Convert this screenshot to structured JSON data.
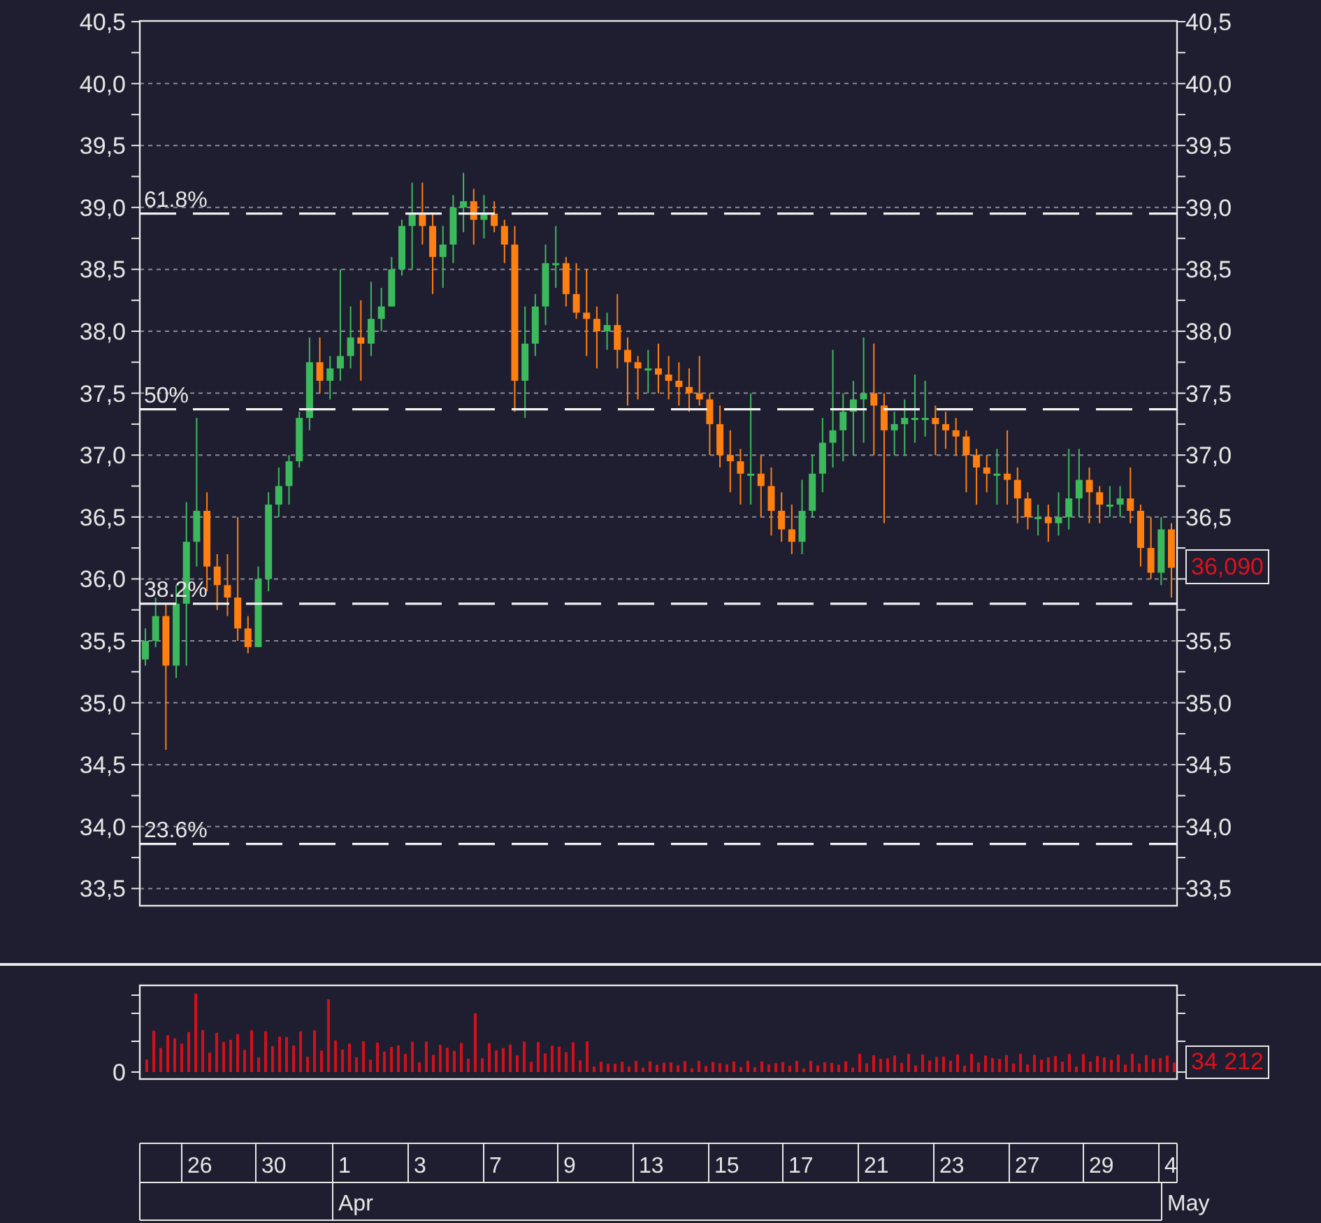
{
  "price_chart": {
    "right_axis": {
      "ticks": [
        "40,5",
        "40,0",
        "39,5",
        "39,0",
        "38,5",
        "38,0",
        "37,5",
        "37,0",
        "36,5",
        "35,5",
        "35,0",
        "34,5",
        "34,0",
        "33,5"
      ]
    },
    "fibonacci_levels": [
      {
        "label": "61.8%"
      },
      {
        "label": "50%"
      },
      {
        "label": "38.2%"
      },
      {
        "label": "23.6%"
      }
    ],
    "last_price": "36,090",
    "chart_data": {
      "type": "candlestick",
      "grid": true,
      "ylim": [
        33.36,
        40.5
      ],
      "yticks": [
        {
          "value": 40.5,
          "label": "40,5"
        },
        {
          "value": 40,
          "label": "40,0"
        },
        {
          "value": 39.5,
          "label": "39,5"
        },
        {
          "value": 39,
          "label": "39,0"
        },
        {
          "value": 38.5,
          "label": "38,5"
        },
        {
          "value": 38,
          "label": "38,0"
        },
        {
          "value": 37.5,
          "label": "37,5"
        },
        {
          "value": 37,
          "label": "37,0"
        },
        {
          "value": 36.5,
          "label": "36,5"
        },
        {
          "value": 36,
          "label": "36,0"
        },
        {
          "value": 35.5,
          "label": "35,5"
        },
        {
          "value": 35,
          "label": "35,0"
        },
        {
          "value": 34.5,
          "label": "34,5"
        },
        {
          "value": 34,
          "label": "34,0"
        },
        {
          "value": 33.5,
          "label": "33,5"
        }
      ],
      "categories": [
        null,
        null,
        null,
        null,
        null,
        null,
        null,
        null,
        null,
        null,
        null,
        null,
        null,
        null,
        null,
        null,
        null,
        null,
        null,
        null,
        null,
        null,
        null,
        null,
        null,
        null,
        null,
        null,
        null,
        null,
        null,
        null,
        null,
        null,
        null,
        null,
        null,
        null,
        null,
        null,
        null,
        null,
        null,
        null,
        null,
        null,
        null,
        null,
        null,
        null,
        null,
        null,
        null,
        null,
        null,
        null,
        null,
        null,
        null,
        null,
        null,
        null,
        null,
        null,
        null,
        null,
        null,
        null,
        null,
        null,
        null,
        null,
        null,
        null,
        null,
        null,
        null,
        null,
        null,
        null,
        null,
        null,
        null,
        null,
        null,
        null,
        null,
        null,
        null,
        null,
        null,
        null,
        null,
        null,
        null,
        null,
        null,
        null,
        null,
        null,
        null
      ],
      "ohlc": [
        [
          35.35,
          35.6,
          35.3,
          35.5
        ],
        [
          35.5,
          35.85,
          35.45,
          35.7
        ],
        [
          35.7,
          35.8,
          34.62,
          35.3
        ],
        [
          35.3,
          35.95,
          35.2,
          35.8
        ],
        [
          35.8,
          36.62,
          35.3,
          36.3
        ],
        [
          36.3,
          37.3,
          36.1,
          36.55
        ],
        [
          36.55,
          36.7,
          35.9,
          36.1
        ],
        [
          36.1,
          36.2,
          35.75,
          35.95
        ],
        [
          35.95,
          36.2,
          35.7,
          35.85
        ],
        [
          35.85,
          36.5,
          35.5,
          35.6
        ],
        [
          35.6,
          35.7,
          35.4,
          35.45
        ],
        [
          35.45,
          36.1,
          35.45,
          36.0
        ],
        [
          36.0,
          36.7,
          35.9,
          36.6
        ],
        [
          36.6,
          36.9,
          36.5,
          36.75
        ],
        [
          36.75,
          37.0,
          36.6,
          36.95
        ],
        [
          36.95,
          37.35,
          36.9,
          37.3
        ],
        [
          37.3,
          37.95,
          37.2,
          37.75
        ],
        [
          37.75,
          37.95,
          37.5,
          37.6
        ],
        [
          37.6,
          37.8,
          37.45,
          37.7
        ],
        [
          37.7,
          38.5,
          37.6,
          37.8
        ],
        [
          37.8,
          38.2,
          37.7,
          37.95
        ],
        [
          37.95,
          38.25,
          37.6,
          37.9
        ],
        [
          37.9,
          38.4,
          37.8,
          38.1
        ],
        [
          38.1,
          38.35,
          38.0,
          38.2
        ],
        [
          38.2,
          38.6,
          38.2,
          38.5
        ],
        [
          38.5,
          38.9,
          38.45,
          38.85
        ],
        [
          38.85,
          39.2,
          38.5,
          38.95
        ],
        [
          38.95,
          39.2,
          38.7,
          38.85
        ],
        [
          38.85,
          38.95,
          38.3,
          38.6
        ],
        [
          38.6,
          38.85,
          38.35,
          38.7
        ],
        [
          38.7,
          39.1,
          38.55,
          39.0
        ],
        [
          39.0,
          39.28,
          38.8,
          39.05
        ],
        [
          39.05,
          39.15,
          38.7,
          38.9
        ],
        [
          38.9,
          39.1,
          38.75,
          38.95
        ],
        [
          38.95,
          39.05,
          38.8,
          38.85
        ],
        [
          38.85,
          38.9,
          38.55,
          38.7
        ],
        [
          38.7,
          38.85,
          37.35,
          37.6
        ],
        [
          37.6,
          38.2,
          37.3,
          37.9
        ],
        [
          37.9,
          38.3,
          37.8,
          38.2
        ],
        [
          38.2,
          38.7,
          38.05,
          38.55
        ],
        [
          38.55,
          38.85,
          38.35,
          38.55
        ],
        [
          38.55,
          38.6,
          38.2,
          38.3
        ],
        [
          38.3,
          38.55,
          38.1,
          38.15
        ],
        [
          38.15,
          38.5,
          37.8,
          38.1
        ],
        [
          38.1,
          38.2,
          37.7,
          38.0
        ],
        [
          38.0,
          38.15,
          37.85,
          38.05
        ],
        [
          38.05,
          38.3,
          37.7,
          37.85
        ],
        [
          37.85,
          37.95,
          37.4,
          37.75
        ],
        [
          37.75,
          37.8,
          37.45,
          37.7
        ],
        [
          37.7,
          37.85,
          37.5,
          37.7
        ],
        [
          37.7,
          37.9,
          37.5,
          37.65
        ],
        [
          37.65,
          37.8,
          37.45,
          37.6
        ],
        [
          37.6,
          37.75,
          37.4,
          37.55
        ],
        [
          37.55,
          37.7,
          37.35,
          37.5
        ],
        [
          37.5,
          37.8,
          37.4,
          37.45
        ],
        [
          37.45,
          37.5,
          37.0,
          37.25
        ],
        [
          37.25,
          37.4,
          36.9,
          37.0
        ],
        [
          37.0,
          37.2,
          36.7,
          36.95
        ],
        [
          36.95,
          37.05,
          36.6,
          36.85
        ],
        [
          36.85,
          37.5,
          36.6,
          36.85
        ],
        [
          36.85,
          37.0,
          36.5,
          36.75
        ],
        [
          36.75,
          36.9,
          36.35,
          36.55
        ],
        [
          36.55,
          36.7,
          36.3,
          36.4
        ],
        [
          36.4,
          36.6,
          36.2,
          36.3
        ],
        [
          36.3,
          36.8,
          36.2,
          36.55
        ],
        [
          36.55,
          37.0,
          36.5,
          36.85
        ],
        [
          36.85,
          37.3,
          36.7,
          37.1
        ],
        [
          37.1,
          37.85,
          36.9,
          37.2
        ],
        [
          37.2,
          37.5,
          36.95,
          37.35
        ],
        [
          37.35,
          37.6,
          37.0,
          37.45
        ],
        [
          37.45,
          37.95,
          37.1,
          37.5
        ],
        [
          37.5,
          37.9,
          37.0,
          37.4
        ],
        [
          37.4,
          37.5,
          36.45,
          37.2
        ],
        [
          37.2,
          37.35,
          37.0,
          37.25
        ],
        [
          37.25,
          37.45,
          37.0,
          37.3
        ],
        [
          37.3,
          37.65,
          37.1,
          37.3
        ],
        [
          37.3,
          37.6,
          37.15,
          37.3
        ],
        [
          37.3,
          37.4,
          37.0,
          37.25
        ],
        [
          37.25,
          37.35,
          37.05,
          37.2
        ],
        [
          37.2,
          37.3,
          37.0,
          37.15
        ],
        [
          37.15,
          37.2,
          36.7,
          37.0
        ],
        [
          37.0,
          37.05,
          36.6,
          36.9
        ],
        [
          36.9,
          37.0,
          36.7,
          36.85
        ],
        [
          36.85,
          37.05,
          36.6,
          36.85
        ],
        [
          36.85,
          37.2,
          36.6,
          36.8
        ],
        [
          36.8,
          36.9,
          36.45,
          36.65
        ],
        [
          36.65,
          36.7,
          36.4,
          36.5
        ],
        [
          36.5,
          36.6,
          36.35,
          36.5
        ],
        [
          36.5,
          36.6,
          36.3,
          36.45
        ],
        [
          36.45,
          36.7,
          36.35,
          36.5
        ],
        [
          36.5,
          37.05,
          36.4,
          36.65
        ],
        [
          36.65,
          37.05,
          36.5,
          36.8
        ],
        [
          36.8,
          36.9,
          36.45,
          36.7
        ],
        [
          36.7,
          36.75,
          36.45,
          36.6
        ],
        [
          36.6,
          36.75,
          36.5,
          36.6
        ],
        [
          36.6,
          36.75,
          36.5,
          36.65
        ],
        [
          36.65,
          36.9,
          36.45,
          36.55
        ],
        [
          36.55,
          36.6,
          36.1,
          36.25
        ],
        [
          36.25,
          36.5,
          36.0,
          36.05
        ],
        [
          36.05,
          36.5,
          35.95,
          36.4
        ],
        [
          36.4,
          36.45,
          35.85,
          36.09
        ]
      ]
    }
  },
  "volume_chart": {
    "axis_label": "0",
    "last_volume": "34 212"
  },
  "date_axis": {
    "days": [
      "26",
      "30",
      "1",
      "3",
      "7",
      "9",
      "13",
      "15",
      "17",
      "21",
      "23",
      "27",
      "29",
      "4"
    ],
    "months": [
      "Apr",
      "May"
    ]
  }
}
